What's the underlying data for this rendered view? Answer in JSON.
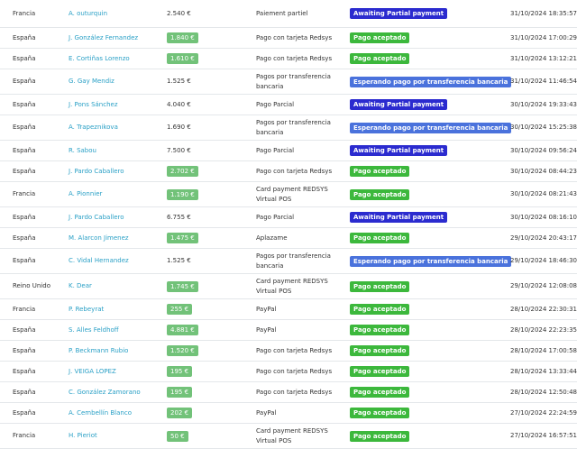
{
  "status_colors": {
    "Awaiting Partial payment": "#2b2bcf",
    "Pago aceptado": "#3cb83c",
    "Esperando pago por transferencia bancaria": "#4a72dc"
  },
  "orders": [
    {
      "country": "Francia",
      "customer": "A. outurquin",
      "total": "2.540 €",
      "total_badge": false,
      "payment": "Paiement partiel",
      "status": "Awaiting Partial payment",
      "date": "31/10/2024 18:35:57"
    },
    {
      "country": "España",
      "customer": "J. González Fernandez",
      "total": "1.840 €",
      "total_badge": true,
      "payment": "Pago con tarjeta Redsys",
      "status": "Pago aceptado",
      "date": "31/10/2024 17:00:29"
    },
    {
      "country": "España",
      "customer": "E. Cortiñas Lorenzo",
      "total": "1.610 €",
      "total_badge": true,
      "payment": "Pago con tarjeta Redsys",
      "status": "Pago aceptado",
      "date": "31/10/2024 13:12:21"
    },
    {
      "country": "España",
      "customer": "G. Gay Mendiz",
      "total": "1.525 €",
      "total_badge": false,
      "payment": "Pagos por transferencia bancaria",
      "status": "Esperando pago por transferencia bancaria",
      "date": "31/10/2024 11:46:54"
    },
    {
      "country": "España",
      "customer": "J. Pons Sánchez",
      "total": "4.040 €",
      "total_badge": false,
      "payment": "Pago Parcial",
      "status": "Awaiting Partial payment",
      "date": "30/10/2024 19:33:43"
    },
    {
      "country": "España",
      "customer": "A. Trapeznikova",
      "total": "1.690 €",
      "total_badge": false,
      "payment": "Pagos por transferencia bancaria",
      "status": "Esperando pago por transferencia bancaria",
      "date": "30/10/2024 15:25:38"
    },
    {
      "country": "España",
      "customer": "R. Sabou",
      "total": "7.500 €",
      "total_badge": false,
      "payment": "Pago Parcial",
      "status": "Awaiting Partial payment",
      "date": "30/10/2024 09:56:24"
    },
    {
      "country": "España",
      "customer": "J. Pardo Caballero",
      "total": "2.702 €",
      "total_badge": true,
      "payment": "Pago con tarjeta Redsys",
      "status": "Pago aceptado",
      "date": "30/10/2024 08:44:23"
    },
    {
      "country": "Francia",
      "customer": "A. Pionnier",
      "total": "1.190 €",
      "total_badge": true,
      "payment": "Card payment REDSYS Virtual POS",
      "status": "Pago aceptado",
      "date": "30/10/2024 08:21:43"
    },
    {
      "country": "España",
      "customer": "J. Pardo Caballero",
      "total": "6.755 €",
      "total_badge": false,
      "payment": "Pago Parcial",
      "status": "Awaiting Partial payment",
      "date": "30/10/2024 08:16:10"
    },
    {
      "country": "España",
      "customer": "M. Alarcon Jimenez",
      "total": "1.475 €",
      "total_badge": true,
      "payment": "Aplazame",
      "status": "Pago aceptado",
      "date": "29/10/2024 20:43:17"
    },
    {
      "country": "España",
      "customer": "C. Vidal Hernandez",
      "total": "1.525 €",
      "total_badge": false,
      "payment": "Pagos por transferencia bancaria",
      "status": "Esperando pago por transferencia bancaria",
      "date": "29/10/2024 18:46:30"
    },
    {
      "country": "Reino Unido",
      "customer": "K. Dear",
      "total": "1.745 €",
      "total_badge": true,
      "payment": "Card payment REDSYS Virtual POS",
      "status": "Pago aceptado",
      "date": "29/10/2024 12:08:08"
    },
    {
      "country": "Francia",
      "customer": "P. Rebeyrat",
      "total": "255 €",
      "total_badge": true,
      "payment": "PayPal",
      "status": "Pago aceptado",
      "date": "28/10/2024 22:30:31"
    },
    {
      "country": "España",
      "customer": "S. Alles Feldhoff",
      "total": "4.881 €",
      "total_badge": true,
      "payment": "PayPal",
      "status": "Pago aceptado",
      "date": "28/10/2024 22:23:35"
    },
    {
      "country": "España",
      "customer": "P. Beckmann Rubio",
      "total": "1.520 €",
      "total_badge": true,
      "payment": "Pago con tarjeta Redsys",
      "status": "Pago aceptado",
      "date": "28/10/2024 17:00:58"
    },
    {
      "country": "España",
      "customer": "J. VEIGA LOPEZ",
      "total": "195 €",
      "total_badge": true,
      "payment": "Pago con tarjeta Redsys",
      "status": "Pago aceptado",
      "date": "28/10/2024 13:33:44"
    },
    {
      "country": "España",
      "customer": "C. González Zamorano",
      "total": "195 €",
      "total_badge": true,
      "payment": "Pago con tarjeta Redsys",
      "status": "Pago aceptado",
      "date": "28/10/2024 12:50:48"
    },
    {
      "country": "España",
      "customer": "A. Cembellín Blanco",
      "total": "202 €",
      "total_badge": true,
      "payment": "PayPal",
      "status": "Pago aceptado",
      "date": "27/10/2024 22:24:59"
    },
    {
      "country": "Francia",
      "customer": "H. Pieriot",
      "total": "50 €",
      "total_badge": true,
      "payment": "Card payment REDSYS Virtual POS",
      "status": "Pago aceptado",
      "date": "27/10/2024 16:57:51"
    }
  ]
}
